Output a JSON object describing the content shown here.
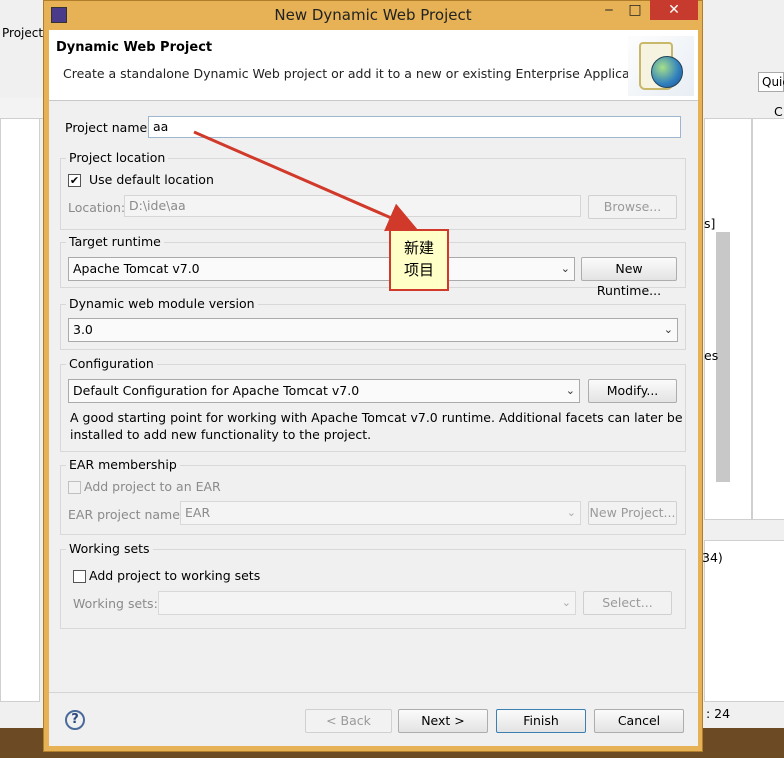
{
  "window": {
    "title": "New Dynamic Web Project",
    "minimize": "‒",
    "maximize": "□",
    "close": "✕"
  },
  "bg": {
    "project_tab": "Project",
    "quick_access": "Quic",
    "side_c": "C",
    "text_s1": "s]",
    "text_s2": "es",
    "text_34": "34)",
    "status": ": 24"
  },
  "banner": {
    "title": "Dynamic Web Project",
    "description": "Create a standalone Dynamic Web project or add it to a new or existing Enterprise Application."
  },
  "project_name": {
    "label": "Project name:",
    "value": "aa"
  },
  "project_location": {
    "group_label": "Project location",
    "use_default_label": "Use default location",
    "use_default_checked": true,
    "location_label": "Location:",
    "location_value": "D:\\ide\\aa",
    "browse_button": "Browse..."
  },
  "target_runtime": {
    "group_label": "Target runtime",
    "selected": "Apache Tomcat v7.0",
    "new_runtime_button": "New Runtime..."
  },
  "module_version": {
    "group_label": "Dynamic web module version",
    "selected": "3.0"
  },
  "configuration": {
    "group_label": "Configuration",
    "selected": "Default Configuration for Apache Tomcat v7.0",
    "modify_button": "Modify...",
    "description_line1": "A good starting point for working with Apache Tomcat v7.0 runtime. Additional facets can later be",
    "description_line2": "installed to add new functionality to the project."
  },
  "ear": {
    "group_label": "EAR membership",
    "add_label": "Add project to an EAR",
    "add_checked": false,
    "name_label": "EAR project name:",
    "name_value": "EAR",
    "new_project_button": "New Project..."
  },
  "working_sets": {
    "group_label": "Working sets",
    "add_label": "Add project to working sets",
    "add_checked": false,
    "sets_label": "Working sets:",
    "sets_value": "",
    "select_button": "Select..."
  },
  "annotation": {
    "line1": "新建",
    "line2": "项目",
    "arrow_color": "#d13a2a"
  },
  "footer": {
    "help": "?",
    "back": "< Back",
    "next": "Next >",
    "finish": "Finish",
    "cancel": "Cancel"
  }
}
